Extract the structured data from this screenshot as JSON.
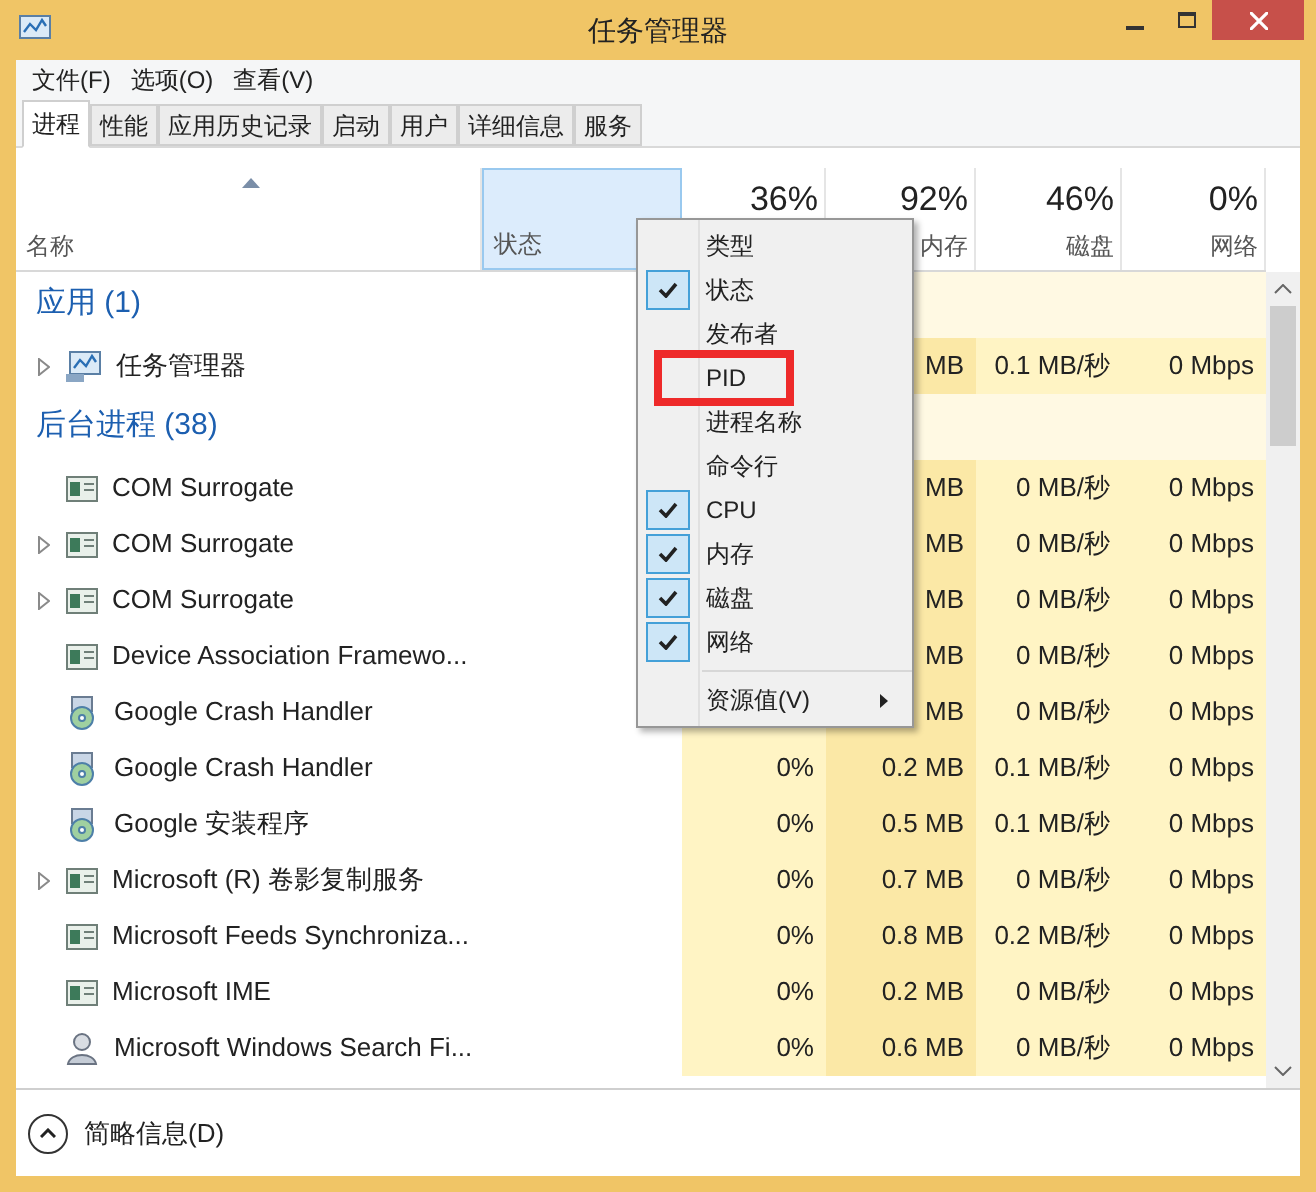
{
  "window": {
    "title": "任务管理器"
  },
  "menu_bar": [
    "文件(F)",
    "选项(O)",
    "查看(V)"
  ],
  "tabs": [
    {
      "label": "进程",
      "selected": true
    },
    {
      "label": "性能",
      "selected": false
    },
    {
      "label": "应用历史记录",
      "selected": false
    },
    {
      "label": "启动",
      "selected": false
    },
    {
      "label": "用户",
      "selected": false
    },
    {
      "label": "详细信息",
      "selected": false
    },
    {
      "label": "服务",
      "selected": false
    }
  ],
  "columns": [
    {
      "kind": "name",
      "label": "名称",
      "highlighted": false
    },
    {
      "kind": "status",
      "label": "状态",
      "highlighted": true
    },
    {
      "kind": "cpu",
      "percent": "36%",
      "highlighted": false
    },
    {
      "kind": "memory",
      "label": "内存",
      "percent": "92%",
      "highlighted": false
    },
    {
      "kind": "disk",
      "label": "磁盘",
      "percent": "46%",
      "highlighted": false
    },
    {
      "kind": "network",
      "label": "网络",
      "percent": "0%",
      "highlighted": false
    }
  ],
  "groups": [
    {
      "title": "应用 (1)",
      "rows": [
        {
          "name": "任务管理器",
          "kind": "monitor",
          "expandable": true,
          "memory": "MB",
          "disk": "0.1 MB/秒",
          "network": "0 Mbps"
        }
      ]
    },
    {
      "title": "后台进程 (38)",
      "rows": [
        {
          "name": "COM Surrogate",
          "kind": "window",
          "expandable": false,
          "memory": "MB",
          "disk": "0 MB/秒",
          "network": "0 Mbps"
        },
        {
          "name": "COM Surrogate",
          "kind": "window",
          "expandable": true,
          "memory": "MB",
          "disk": "0 MB/秒",
          "network": "0 Mbps"
        },
        {
          "name": "COM Surrogate",
          "kind": "window",
          "expandable": true,
          "memory": "MB",
          "disk": "0 MB/秒",
          "network": "0 Mbps"
        },
        {
          "name": "Device Association Framewo...",
          "kind": "window",
          "expandable": false,
          "memory": "MB",
          "disk": "0 MB/秒",
          "network": "0 Mbps"
        },
        {
          "name": "Google Crash Handler",
          "kind": "installer",
          "expandable": false,
          "memory": "MB",
          "disk": "0 MB/秒",
          "network": "0 Mbps"
        },
        {
          "name": "Google Crash Handler",
          "kind": "installer",
          "expandable": false,
          "cpu": "0%",
          "memory": "0.2 MB",
          "disk": "0.1 MB/秒",
          "network": "0 Mbps"
        },
        {
          "name": "Google 安装程序",
          "kind": "installer",
          "expandable": false,
          "cpu": "0%",
          "memory": "0.5 MB",
          "disk": "0.1 MB/秒",
          "network": "0 Mbps"
        },
        {
          "name": "Microsoft (R) 卷影复制服务",
          "kind": "window",
          "expandable": true,
          "cpu": "0%",
          "memory": "0.7 MB",
          "disk": "0 MB/秒",
          "network": "0 Mbps"
        },
        {
          "name": "Microsoft Feeds Synchroniza...",
          "kind": "window",
          "expandable": false,
          "cpu": "0%",
          "memory": "0.8 MB",
          "disk": "0.2 MB/秒",
          "network": "0 Mbps"
        },
        {
          "name": "Microsoft IME",
          "kind": "window",
          "expandable": false,
          "cpu": "0%",
          "memory": "0.2 MB",
          "disk": "0 MB/秒",
          "network": "0 Mbps"
        },
        {
          "name": "Microsoft Windows Search Fi...",
          "kind": "person",
          "expandable": false,
          "cpu": "0%",
          "memory": "0.6 MB",
          "disk": "0 MB/秒",
          "network": "0 Mbps"
        }
      ]
    }
  ],
  "context_menu": [
    {
      "label": "类型",
      "kind": "item",
      "checked": false,
      "highlighted": false
    },
    {
      "label": "状态",
      "kind": "item",
      "checked": true,
      "highlighted": false
    },
    {
      "label": "发布者",
      "kind": "item",
      "checked": false,
      "highlighted": false
    },
    {
      "label": "PID",
      "kind": "item",
      "checked": false,
      "highlighted": true
    },
    {
      "label": "进程名称",
      "kind": "item",
      "checked": false,
      "highlighted": false
    },
    {
      "label": "命令行",
      "kind": "item",
      "checked": false,
      "highlighted": false
    },
    {
      "label": "CPU",
      "kind": "item",
      "checked": true,
      "highlighted": false
    },
    {
      "label": "内存",
      "kind": "item",
      "checked": true,
      "highlighted": false
    },
    {
      "label": "磁盘",
      "kind": "item",
      "checked": true,
      "highlighted": false
    },
    {
      "label": "网络",
      "kind": "item",
      "checked": true,
      "highlighted": false
    },
    {
      "label": "资源值(V)",
      "kind": "submenu",
      "checked": false,
      "highlighted": false
    }
  ],
  "footer": {
    "label": "简略信息(D)"
  }
}
